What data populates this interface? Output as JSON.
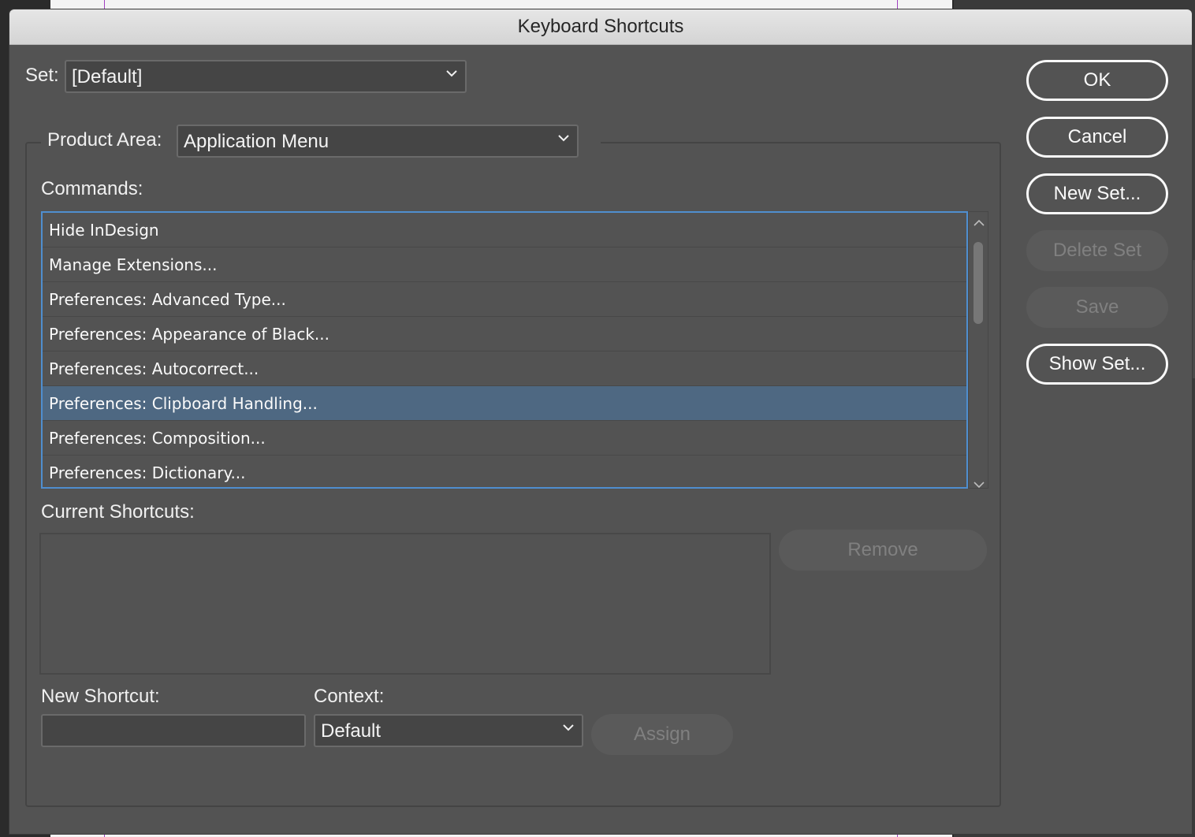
{
  "dialog": {
    "title": "Keyboard Shortcuts"
  },
  "set": {
    "label": "Set:",
    "value": "[Default]"
  },
  "product_area": {
    "label": "Product Area:",
    "value": "Application Menu"
  },
  "commands": {
    "label": "Commands:",
    "items": [
      {
        "label": "Hide InDesign",
        "selected": false
      },
      {
        "label": "Manage Extensions...",
        "selected": false
      },
      {
        "label": "Preferences: Advanced Type...",
        "selected": false
      },
      {
        "label": "Preferences: Appearance of Black...",
        "selected": false
      },
      {
        "label": "Preferences: Autocorrect...",
        "selected": false
      },
      {
        "label": "Preferences: Clipboard Handling...",
        "selected": true
      },
      {
        "label": "Preferences: Composition...",
        "selected": false
      },
      {
        "label": "Preferences: Dictionary...",
        "selected": false
      }
    ]
  },
  "current_shortcuts": {
    "label": "Current Shortcuts:",
    "remove_label": "Remove"
  },
  "new_shortcut": {
    "label": "New Shortcut:",
    "value": ""
  },
  "context": {
    "label": "Context:",
    "value": "Default"
  },
  "assign_label": "Assign",
  "buttons": {
    "ok": "OK",
    "cancel": "Cancel",
    "new_set": "New Set...",
    "delete_set": "Delete Set",
    "save": "Save",
    "show_set": "Show Set..."
  },
  "colors": {
    "dialog_bg": "#535353",
    "selection": "#4e6882",
    "focus_ring": "#4f8ecf",
    "guide": "#a040c0"
  }
}
